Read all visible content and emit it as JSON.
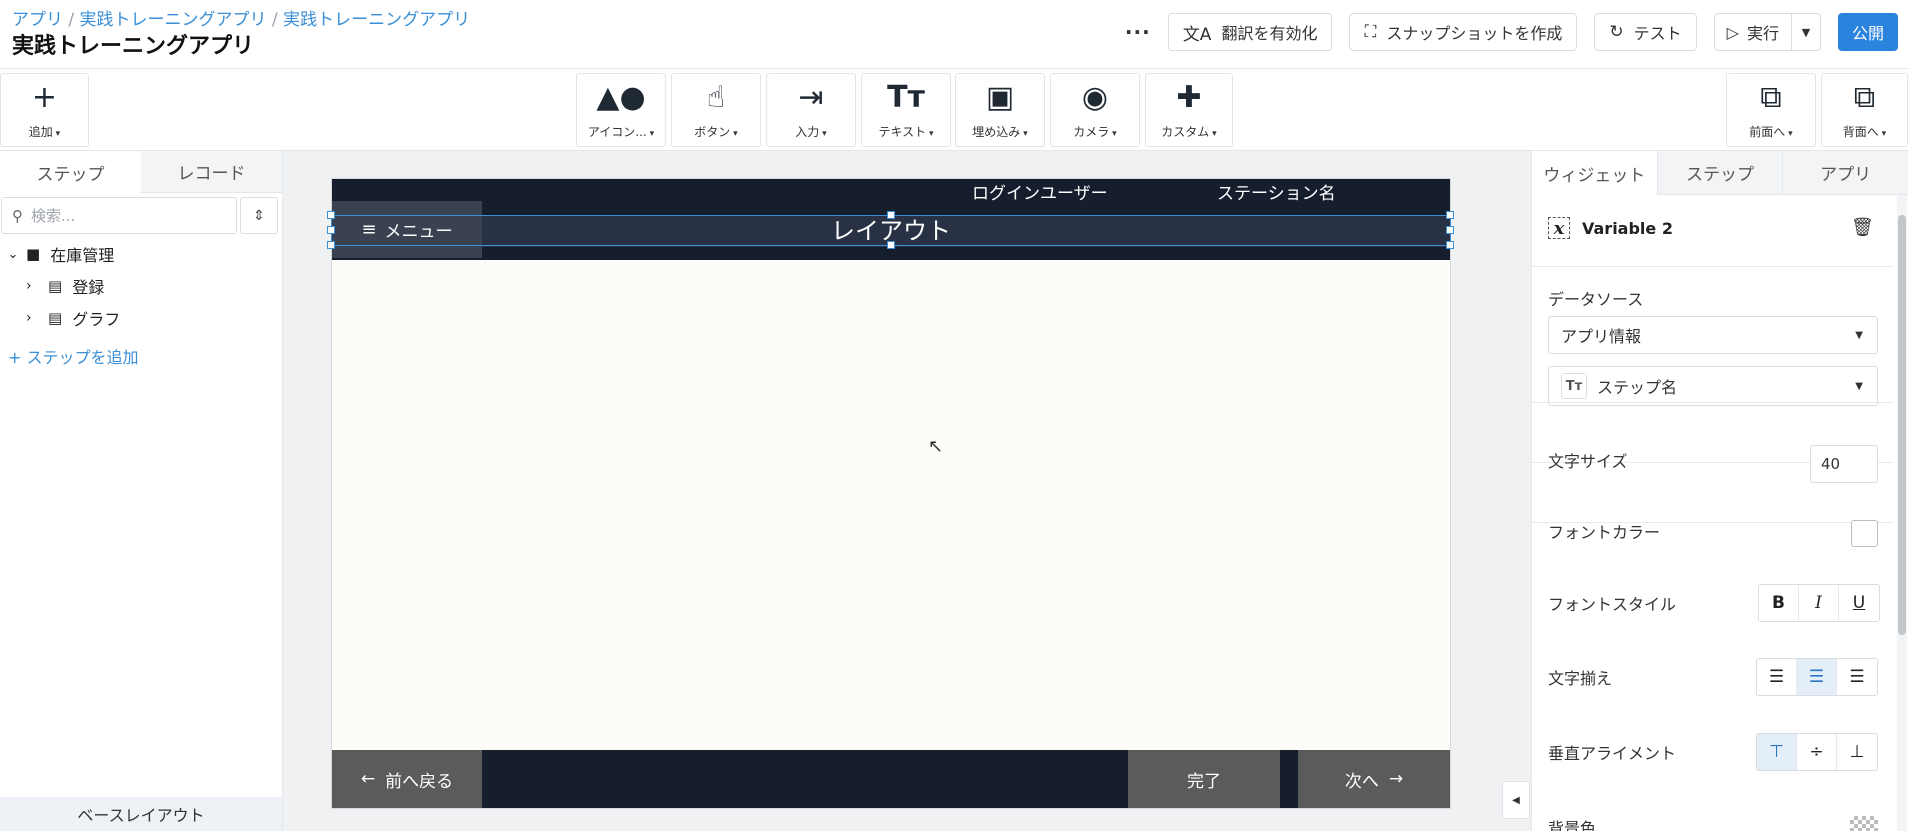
{
  "header": {
    "breadcrumb": [
      "アプリ",
      "実践トレーニングアプリ",
      "実践トレーニングアプリ"
    ],
    "title": "実践トレーニングアプリ",
    "more": "···",
    "translate_label": "翻訳を有効化",
    "snapshot_label": "スナップショットを作成",
    "test_label": "テスト",
    "run_label": "実行",
    "publish_label": "公開"
  },
  "toolbar": {
    "add_label": "追加",
    "items": [
      {
        "label": "アイコン..."
      },
      {
        "label": "ボタン"
      },
      {
        "label": "入力"
      },
      {
        "label": "テキスト"
      },
      {
        "label": "埋め込み"
      },
      {
        "label": "カメラ"
      },
      {
        "label": "カスタム"
      }
    ],
    "bring_front": "前面へ",
    "send_back": "背面へ"
  },
  "left_panel": {
    "tabs": [
      "ステップ",
      "レコード"
    ],
    "search_placeholder": "検索...",
    "tree": {
      "folder": "在庫管理",
      "steps": [
        "登録",
        "グラフ"
      ]
    },
    "add_step": "ステップを追加",
    "base_layout": "ベースレイアウト"
  },
  "canvas": {
    "login_user": "ログインユーザー",
    "station_name": "ステーション名",
    "menu_label": "メニュー",
    "layout_title": "レイアウト",
    "prev_label": "前へ戻る",
    "done_label": "完了",
    "next_label": "次へ"
  },
  "right_panel": {
    "tabs": [
      "ウィジェット",
      "ステップ",
      "アプリ"
    ],
    "variable_name": "Variable 2",
    "data_source_label": "データソース",
    "data_source_value": "アプリ情報",
    "field_value": "ステップ名",
    "font_size_label": "文字サイズ",
    "font_size_value": "40",
    "font_color_label": "フォントカラー",
    "font_style_label": "フォントスタイル",
    "align_label": "文字揃え",
    "valign_label": "垂直アライメント",
    "bg_label": "背景色",
    "font_color_value": "#ffffff",
    "active_align": "center",
    "active_valign": "top"
  },
  "colors": {
    "accent": "#2a83dc",
    "screen_header": "#161e2e",
    "footer_button": "#5b5b5b"
  }
}
